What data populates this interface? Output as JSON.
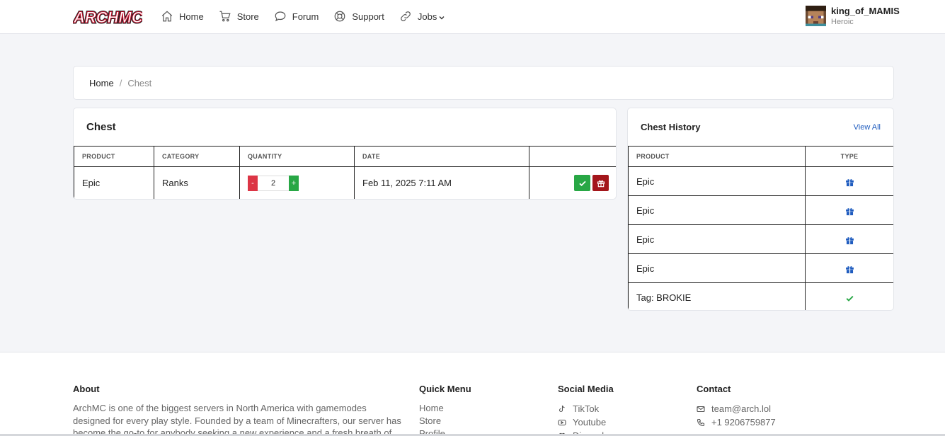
{
  "header": {
    "logo_text": "ARCHMC",
    "nav": [
      {
        "label": "Home",
        "icon": "home-icon"
      },
      {
        "label": "Store",
        "icon": "cart-icon"
      },
      {
        "label": "Forum",
        "icon": "chat-bubble-icon"
      },
      {
        "label": "Support",
        "icon": "lifebuoy-icon"
      },
      {
        "label": "Jobs",
        "icon": "link-icon"
      }
    ],
    "user": {
      "name": "king_of_MAMIS",
      "rank": "Heroic"
    }
  },
  "breadcrumb": {
    "home": "Home",
    "separator": "/",
    "current": "Chest"
  },
  "chest": {
    "title": "Chest",
    "columns": [
      "PRODUCT",
      "CATEGORY",
      "QUANTITY",
      "DATE",
      ""
    ],
    "rows": [
      {
        "product": "Epic",
        "category": "Ranks",
        "quantity": "2",
        "minus": "-",
        "plus": "+",
        "date": "Feb 11, 2025 7:11 AM"
      }
    ]
  },
  "history": {
    "title": "Chest History",
    "view_all": "View All",
    "columns": [
      "PRODUCT",
      "TYPE"
    ],
    "rows": [
      {
        "product": "Epic",
        "type_icon": "gift-icon"
      },
      {
        "product": "Epic",
        "type_icon": "gift-icon"
      },
      {
        "product": "Epic",
        "type_icon": "gift-icon"
      },
      {
        "product": "Epic",
        "type_icon": "gift-icon"
      },
      {
        "product": "Tag: BROKIE",
        "type_icon": "check-icon"
      }
    ]
  },
  "footer": {
    "about": {
      "title": "About",
      "text": "ArchMC is one of the biggest servers in North America with gamemodes designed for every play style. Founded by a team of Minecrafters, our server has become the go-to for anybody seeking a new experience and a fresh breath of gameplay."
    },
    "quick_menu": {
      "title": "Quick Menu",
      "links": [
        "Home",
        "Store",
        "Profile"
      ]
    },
    "social": {
      "title": "Social Media",
      "links": [
        {
          "label": "TikTok",
          "icon": "tiktok-icon"
        },
        {
          "label": "Youtube",
          "icon": "youtube-icon"
        },
        {
          "label": "Discord",
          "icon": "discord-icon"
        }
      ]
    },
    "contact": {
      "title": "Contact",
      "email": "team@arch.lol",
      "phone": "+1 9206759877"
    }
  },
  "colors": {
    "accent": "#1f5cbf",
    "danger": "#dc3545",
    "success": "#28a745",
    "gift": "#a3161b"
  }
}
